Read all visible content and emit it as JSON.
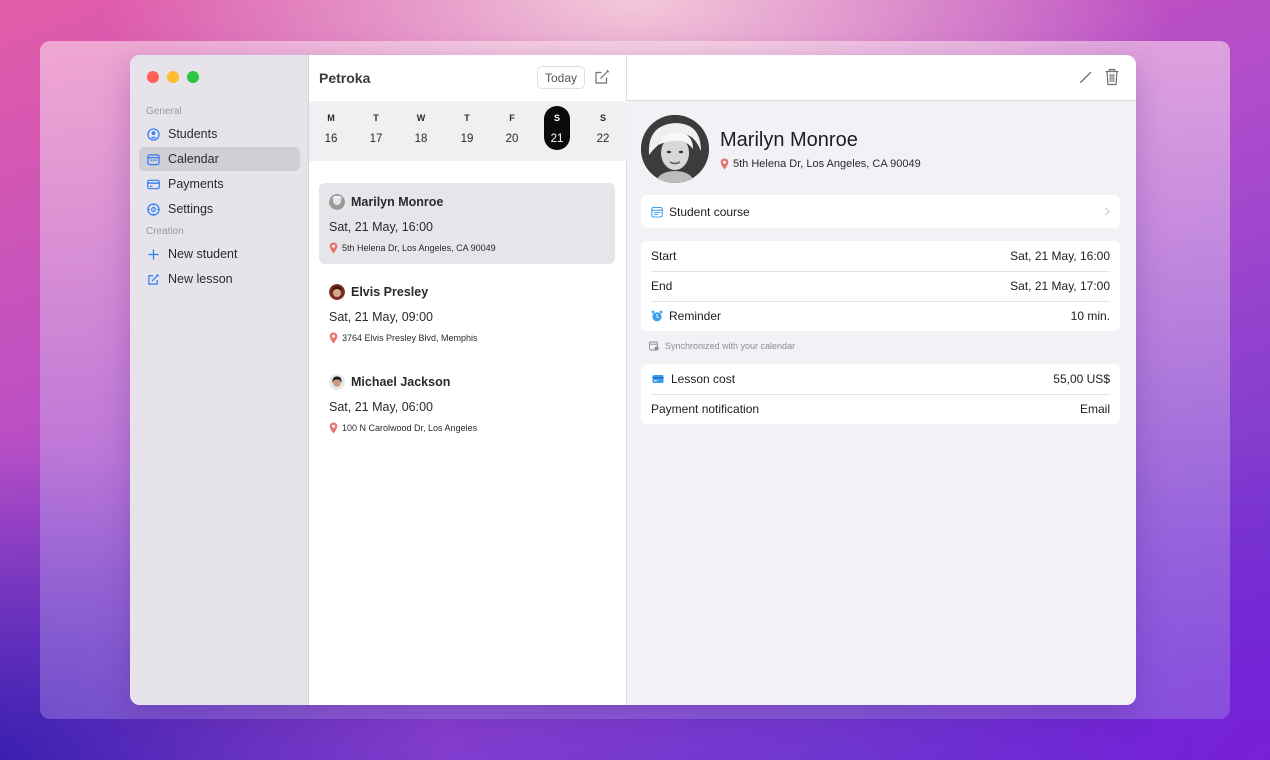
{
  "sidebar": {
    "general_label": "General",
    "creation_label": "Creation",
    "items": [
      {
        "label": "Students",
        "icon": "person-circle-icon"
      },
      {
        "label": "Calendar",
        "icon": "calendar-icon"
      },
      {
        "label": "Payments",
        "icon": "credit-card-icon"
      },
      {
        "label": "Settings",
        "icon": "gear-icon"
      }
    ],
    "creation_items": [
      {
        "label": "New student",
        "icon": "plus-icon"
      },
      {
        "label": "New lesson",
        "icon": "compose-icon"
      }
    ]
  },
  "list": {
    "title": "Petroka",
    "today_label": "Today",
    "week": [
      {
        "letter": "M",
        "num": "16"
      },
      {
        "letter": "T",
        "num": "17"
      },
      {
        "letter": "W",
        "num": "18"
      },
      {
        "letter": "T",
        "num": "19"
      },
      {
        "letter": "F",
        "num": "20"
      },
      {
        "letter": "S",
        "num": "21"
      },
      {
        "letter": "S",
        "num": "22"
      }
    ],
    "lessons": [
      {
        "name": "Marilyn Monroe",
        "time": "Sat, 21 May, 16:00",
        "address": "5th Helena Dr, Los Angeles, CA 90049"
      },
      {
        "name": "Elvis Presley",
        "time": "Sat, 21 May, 09:00",
        "address": "3764 Elvis Presley Blvd, Memphis"
      },
      {
        "name": "Michael Jackson",
        "time": "Sat, 21 May, 06:00",
        "address": "100 N Carolwood Dr, Los Angeles"
      }
    ]
  },
  "detail": {
    "name": "Marilyn Monroe",
    "address": "5th Helena Dr, Los Angeles, CA 90049",
    "course_label": "Student course",
    "start_label": "Start",
    "start_value": "Sat, 21 May, 16:00",
    "end_label": "End",
    "end_value": "Sat, 21 May, 17:00",
    "reminder_label": "Reminder",
    "reminder_value": "10 min.",
    "sync_note": "Synchronized with your calendar",
    "cost_label": "Lesson cost",
    "cost_value": "55,00 US$",
    "notification_label": "Payment notification",
    "notification_value": "Email"
  },
  "colors": {
    "accent": "#2f7cf6",
    "pin": "#e8736f",
    "selected_day": "#0b0b0c"
  }
}
